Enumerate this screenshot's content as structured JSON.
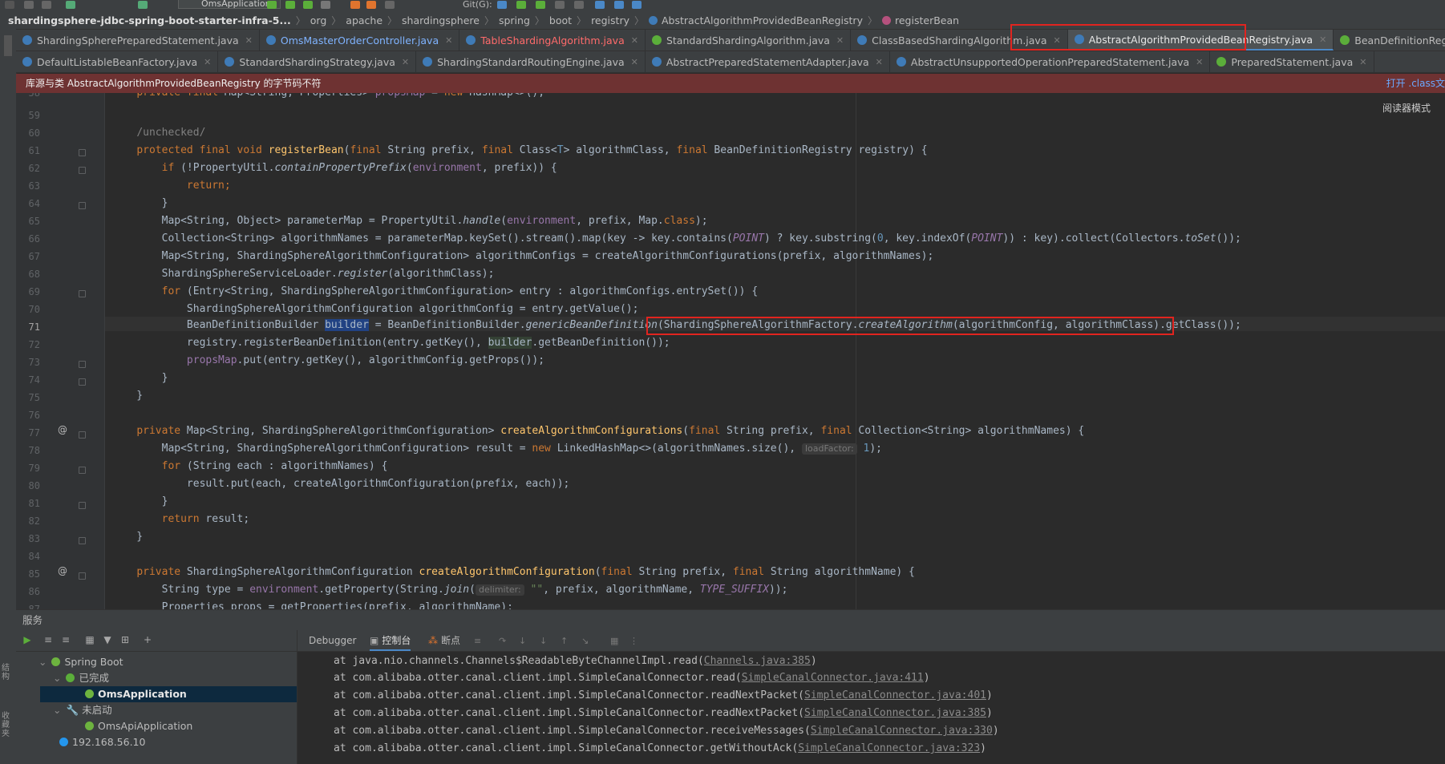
{
  "toolbar": {
    "run_config": "OmsApplication",
    "git_label": "Git(G):"
  },
  "breadcrumb": [
    {
      "label": "shardingsphere-jdbc-spring-boot-starter-infra-5..."
    },
    {
      "label": "org"
    },
    {
      "label": "apache"
    },
    {
      "label": "shardingsphere"
    },
    {
      "label": "spring"
    },
    {
      "label": "boot"
    },
    {
      "label": "registry"
    },
    {
      "label": "AbstractAlgorithmProvidedBeanRegistry"
    },
    {
      "label": "registerBean"
    }
  ],
  "tabs_row1": [
    {
      "label": "ShardingSpherePreparedStatement.java"
    },
    {
      "label": "OmsMasterOrderController.java"
    },
    {
      "label": "TableShardingAlgorithm.java"
    },
    {
      "label": "StandardShardingAlgorithm.java"
    },
    {
      "label": "ClassBasedShardingAlgorithm.java"
    },
    {
      "label": "AbstractAlgorithmProvidedBeanRegistry.java"
    },
    {
      "label": "BeanDefinitionRegistry.java"
    }
  ],
  "tabs_row2": [
    {
      "label": "DefaultListableBeanFactory.java"
    },
    {
      "label": "StandardShardingStrategy.java"
    },
    {
      "label": "ShardingStandardRoutingEngine.java"
    },
    {
      "label": "AbstractPreparedStatementAdapter.java"
    },
    {
      "label": "AbstractUnsupportedOperationPreparedStatement.java"
    },
    {
      "label": "PreparedStatement.java"
    }
  ],
  "warning": {
    "message": "库源与类 AbstractAlgorithmProvidedBeanRegistry 的字节码不符",
    "action": "打开 .class文"
  },
  "editor": {
    "reader_mode": "阅读器模式",
    "line_numbers": [
      "58",
      "59",
      "60",
      "61",
      "62",
      "63",
      "64",
      "65",
      "66",
      "67",
      "68",
      "69",
      "70",
      "71",
      "72",
      "73",
      "74",
      "75",
      "76",
      "77",
      "78",
      "79",
      "80",
      "81",
      "82",
      "83",
      "84",
      "85",
      "86",
      "87"
    ],
    "hints": {
      "load_factor": "loadFactor:",
      "delimiter": "delimiter:"
    }
  },
  "services": {
    "header": "服务",
    "tree": [
      {
        "label": "Spring Boot"
      },
      {
        "label": "已完成"
      },
      {
        "label": "OmsApplication"
      },
      {
        "label": "未启动"
      },
      {
        "label": "OmsApiApplication"
      },
      {
        "label": "192.168.56.10"
      }
    ],
    "side_labels": [
      "结构",
      "收藏夹"
    ]
  },
  "console": {
    "tabs": {
      "debugger": "Debugger",
      "console": "控制台",
      "breakpoints": "断点"
    },
    "lines": [
      {
        "prefix": "at java.nio.channels.Channels$ReadableByteChannelImpl.read(",
        "link": "Channels.java:385",
        "suffix": ")"
      },
      {
        "prefix": "at com.alibaba.otter.canal.client.impl.SimpleCanalConnector.read(",
        "link": "SimpleCanalConnector.java:411",
        "suffix": ")"
      },
      {
        "prefix": "at com.alibaba.otter.canal.client.impl.SimpleCanalConnector.readNextPacket(",
        "link": "SimpleCanalConnector.java:401",
        "suffix": ")"
      },
      {
        "prefix": "at com.alibaba.otter.canal.client.impl.SimpleCanalConnector.readNextPacket(",
        "link": "SimpleCanalConnector.java:385",
        "suffix": ")"
      },
      {
        "prefix": "at com.alibaba.otter.canal.client.impl.SimpleCanalConnector.receiveMessages(",
        "link": "SimpleCanalConnector.java:330",
        "suffix": ")"
      },
      {
        "prefix": "at com.alibaba.otter.canal.client.impl.SimpleCanalConnector.getWithoutAck(",
        "link": "SimpleCanalConnector.java:323",
        "suffix": ")"
      }
    ]
  },
  "colors": {
    "accent": "#4a88c7",
    "highlight_box": "#e1241f",
    "warning_bg": "#6e3232"
  }
}
